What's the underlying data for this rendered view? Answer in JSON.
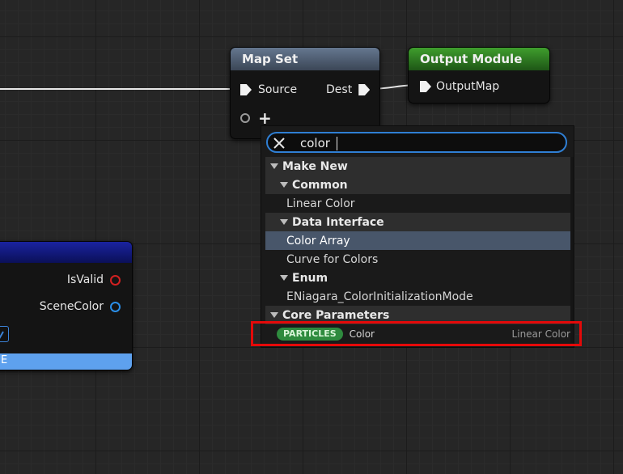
{
  "map_set_node": {
    "title": "Map Set",
    "source_pin": "Source",
    "dest_pin": "Dest",
    "add_pin_glyph": "+"
  },
  "output_module_node": {
    "title": "Output Module",
    "output_map_pin": "OutputMap"
  },
  "left_node": {
    "is_valid_pin": "IsValid",
    "scene_color_pin": "SceneColor",
    "selected_row_text": "E"
  },
  "search": {
    "value": "color",
    "clear_icon": "close-icon"
  },
  "menu": {
    "make_new": "Make New",
    "common": "Common",
    "linear_color": "Linear Color",
    "data_interface": "Data Interface",
    "color_array": "Color Array",
    "curve_for_colors": "Curve for Colors",
    "enum": "Enum",
    "color_init_mode": "ENiagara_ColorInitializationMode",
    "core_parameters": "Core Parameters",
    "particles_badge": "PARTICLES",
    "particles_color": "Color",
    "particles_color_type": "Linear Color"
  },
  "colors": {
    "map_set_header": "#65778f",
    "output_header": "#3f9e2d",
    "search_border": "#2f7fd4",
    "selected_row": "#48566a",
    "highlight": "#e50909",
    "is_valid_pin": "#d22020",
    "scene_color_pin": "#2a8ee8"
  }
}
